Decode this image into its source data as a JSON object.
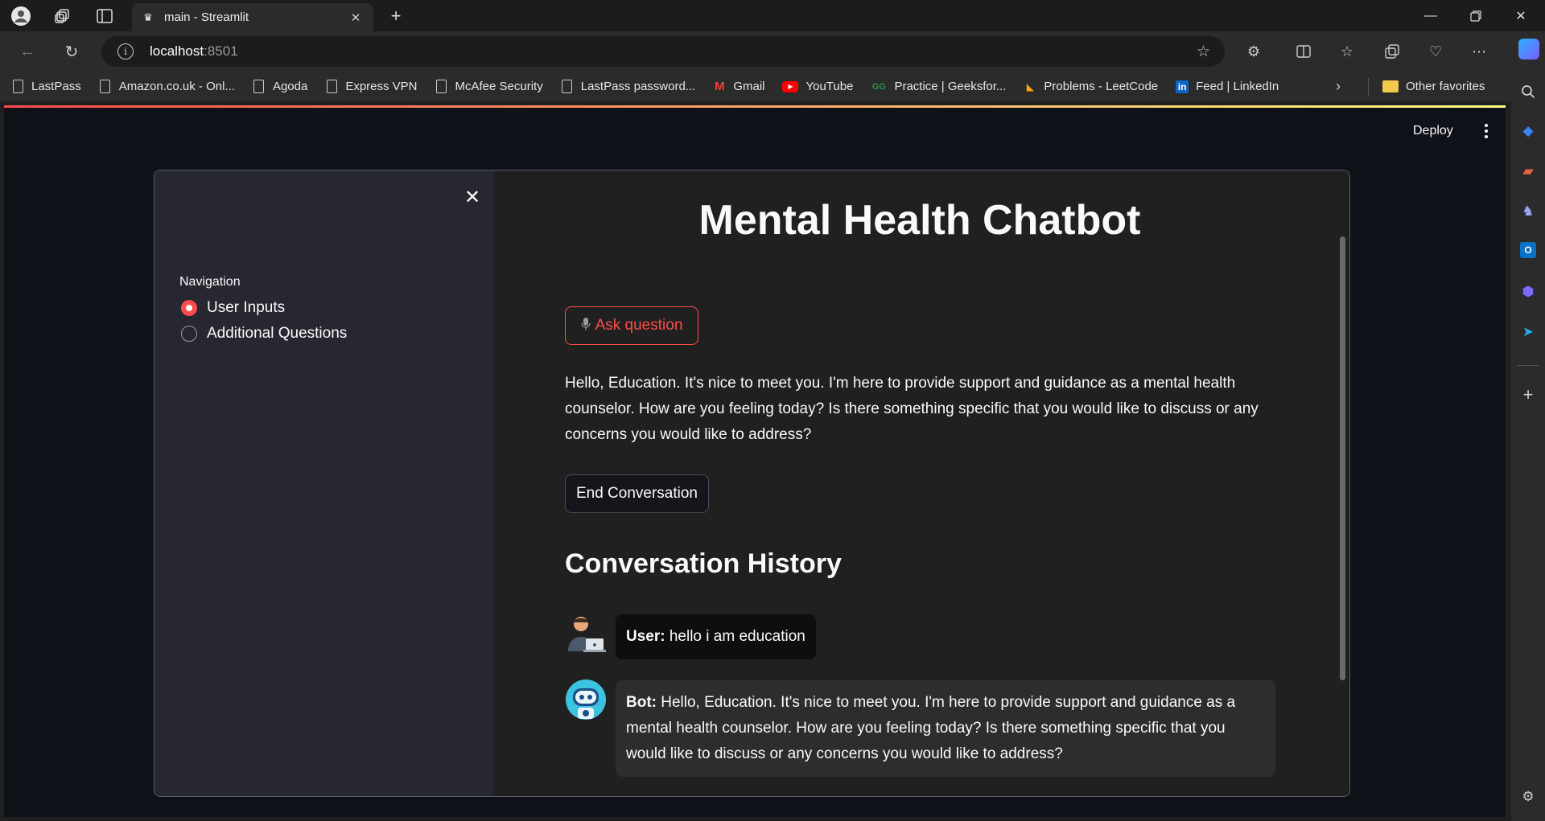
{
  "browser": {
    "tab_title": "main - Streamlit",
    "tab_close": "✕",
    "url_host": "localhost",
    "url_port": ":8501",
    "bookmarks": [
      {
        "label": "LastPass"
      },
      {
        "label": "Amazon.co.uk - Onl..."
      },
      {
        "label": "Agoda"
      },
      {
        "label": "Express VPN"
      },
      {
        "label": "McAfee Security"
      },
      {
        "label": "LastPass password..."
      },
      {
        "label": "Gmail"
      },
      {
        "label": "YouTube"
      },
      {
        "label": "Practice | Geeksfor..."
      },
      {
        "label": "Problems - LeetCode"
      },
      {
        "label": "Feed | LinkedIn"
      }
    ],
    "other_favorites": "Other favorites"
  },
  "app": {
    "deploy_label": "Deploy",
    "sidebar": {
      "close": "✕",
      "nav_label": "Navigation",
      "options": [
        "User Inputs",
        "Additional Questions"
      ],
      "selected": "User Inputs"
    },
    "main": {
      "title": "Mental Health Chatbot",
      "ask_button": "Ask question",
      "reply": "Hello, Education. It's nice to meet you. I'm here to provide support and guidance as a mental health counselor. How are you feeling today? Is there something specific that you would like to discuss or any concerns you would like to address?",
      "end_button": "End Conversation",
      "history_heading": "Conversation History",
      "history": [
        {
          "speaker": "User:",
          "text": " hello i am education"
        },
        {
          "speaker": "Bot:",
          "text": " Hello, Education. It's nice to meet you. I'm here to provide support and guidance as a mental health counselor. How are you feeling today? Is there something specific that you would like to discuss or any concerns you would like to address?"
        }
      ]
    }
  },
  "colors": {
    "accent": "#ff4b4b",
    "app_bg": "#0e1117",
    "sidebar_bg": "#262730"
  }
}
